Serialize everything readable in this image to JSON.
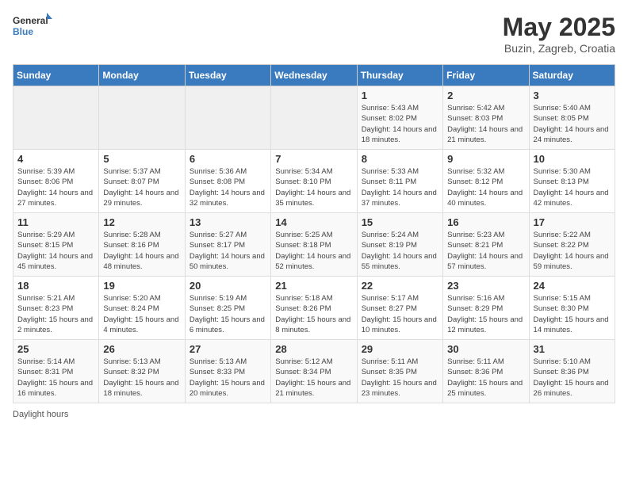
{
  "header": {
    "logo_general": "General",
    "logo_blue": "Blue",
    "title": "May 2025",
    "subtitle": "Buzin, Zagreb, Croatia"
  },
  "days_of_week": [
    "Sunday",
    "Monday",
    "Tuesday",
    "Wednesday",
    "Thursday",
    "Friday",
    "Saturday"
  ],
  "weeks": [
    [
      {
        "day": "",
        "info": ""
      },
      {
        "day": "",
        "info": ""
      },
      {
        "day": "",
        "info": ""
      },
      {
        "day": "",
        "info": ""
      },
      {
        "day": "1",
        "info": "Sunrise: 5:43 AM\nSunset: 8:02 PM\nDaylight: 14 hours and 18 minutes."
      },
      {
        "day": "2",
        "info": "Sunrise: 5:42 AM\nSunset: 8:03 PM\nDaylight: 14 hours and 21 minutes."
      },
      {
        "day": "3",
        "info": "Sunrise: 5:40 AM\nSunset: 8:05 PM\nDaylight: 14 hours and 24 minutes."
      }
    ],
    [
      {
        "day": "4",
        "info": "Sunrise: 5:39 AM\nSunset: 8:06 PM\nDaylight: 14 hours and 27 minutes."
      },
      {
        "day": "5",
        "info": "Sunrise: 5:37 AM\nSunset: 8:07 PM\nDaylight: 14 hours and 29 minutes."
      },
      {
        "day": "6",
        "info": "Sunrise: 5:36 AM\nSunset: 8:08 PM\nDaylight: 14 hours and 32 minutes."
      },
      {
        "day": "7",
        "info": "Sunrise: 5:34 AM\nSunset: 8:10 PM\nDaylight: 14 hours and 35 minutes."
      },
      {
        "day": "8",
        "info": "Sunrise: 5:33 AM\nSunset: 8:11 PM\nDaylight: 14 hours and 37 minutes."
      },
      {
        "day": "9",
        "info": "Sunrise: 5:32 AM\nSunset: 8:12 PM\nDaylight: 14 hours and 40 minutes."
      },
      {
        "day": "10",
        "info": "Sunrise: 5:30 AM\nSunset: 8:13 PM\nDaylight: 14 hours and 42 minutes."
      }
    ],
    [
      {
        "day": "11",
        "info": "Sunrise: 5:29 AM\nSunset: 8:15 PM\nDaylight: 14 hours and 45 minutes."
      },
      {
        "day": "12",
        "info": "Sunrise: 5:28 AM\nSunset: 8:16 PM\nDaylight: 14 hours and 48 minutes."
      },
      {
        "day": "13",
        "info": "Sunrise: 5:27 AM\nSunset: 8:17 PM\nDaylight: 14 hours and 50 minutes."
      },
      {
        "day": "14",
        "info": "Sunrise: 5:25 AM\nSunset: 8:18 PM\nDaylight: 14 hours and 52 minutes."
      },
      {
        "day": "15",
        "info": "Sunrise: 5:24 AM\nSunset: 8:19 PM\nDaylight: 14 hours and 55 minutes."
      },
      {
        "day": "16",
        "info": "Sunrise: 5:23 AM\nSunset: 8:21 PM\nDaylight: 14 hours and 57 minutes."
      },
      {
        "day": "17",
        "info": "Sunrise: 5:22 AM\nSunset: 8:22 PM\nDaylight: 14 hours and 59 minutes."
      }
    ],
    [
      {
        "day": "18",
        "info": "Sunrise: 5:21 AM\nSunset: 8:23 PM\nDaylight: 15 hours and 2 minutes."
      },
      {
        "day": "19",
        "info": "Sunrise: 5:20 AM\nSunset: 8:24 PM\nDaylight: 15 hours and 4 minutes."
      },
      {
        "day": "20",
        "info": "Sunrise: 5:19 AM\nSunset: 8:25 PM\nDaylight: 15 hours and 6 minutes."
      },
      {
        "day": "21",
        "info": "Sunrise: 5:18 AM\nSunset: 8:26 PM\nDaylight: 15 hours and 8 minutes."
      },
      {
        "day": "22",
        "info": "Sunrise: 5:17 AM\nSunset: 8:27 PM\nDaylight: 15 hours and 10 minutes."
      },
      {
        "day": "23",
        "info": "Sunrise: 5:16 AM\nSunset: 8:29 PM\nDaylight: 15 hours and 12 minutes."
      },
      {
        "day": "24",
        "info": "Sunrise: 5:15 AM\nSunset: 8:30 PM\nDaylight: 15 hours and 14 minutes."
      }
    ],
    [
      {
        "day": "25",
        "info": "Sunrise: 5:14 AM\nSunset: 8:31 PM\nDaylight: 15 hours and 16 minutes."
      },
      {
        "day": "26",
        "info": "Sunrise: 5:13 AM\nSunset: 8:32 PM\nDaylight: 15 hours and 18 minutes."
      },
      {
        "day": "27",
        "info": "Sunrise: 5:13 AM\nSunset: 8:33 PM\nDaylight: 15 hours and 20 minutes."
      },
      {
        "day": "28",
        "info": "Sunrise: 5:12 AM\nSunset: 8:34 PM\nDaylight: 15 hours and 21 minutes."
      },
      {
        "day": "29",
        "info": "Sunrise: 5:11 AM\nSunset: 8:35 PM\nDaylight: 15 hours and 23 minutes."
      },
      {
        "day": "30",
        "info": "Sunrise: 5:11 AM\nSunset: 8:36 PM\nDaylight: 15 hours and 25 minutes."
      },
      {
        "day": "31",
        "info": "Sunrise: 5:10 AM\nSunset: 8:36 PM\nDaylight: 15 hours and 26 minutes."
      }
    ]
  ],
  "footer": {
    "daylight_label": "Daylight hours"
  }
}
